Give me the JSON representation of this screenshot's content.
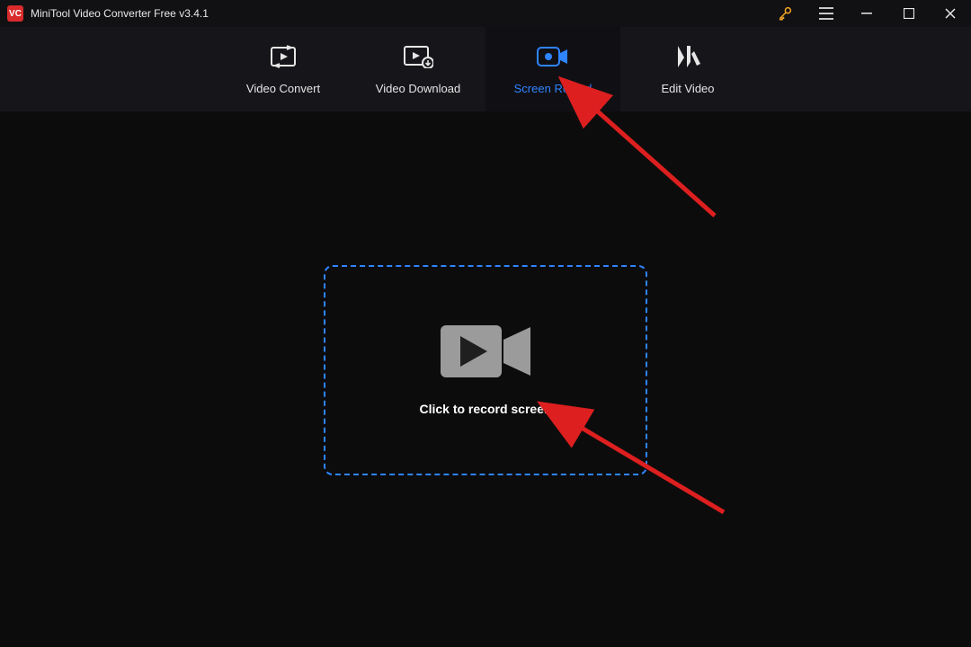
{
  "app": {
    "name": "VC",
    "title": "MiniTool Video Converter Free v3.4.1"
  },
  "tabs": {
    "convert": {
      "label": "Video Convert"
    },
    "download": {
      "label": "Video Download"
    },
    "record": {
      "label": "Screen Record"
    },
    "edit": {
      "label": "Edit Video"
    }
  },
  "main": {
    "record_cta": "Click to record screen"
  }
}
